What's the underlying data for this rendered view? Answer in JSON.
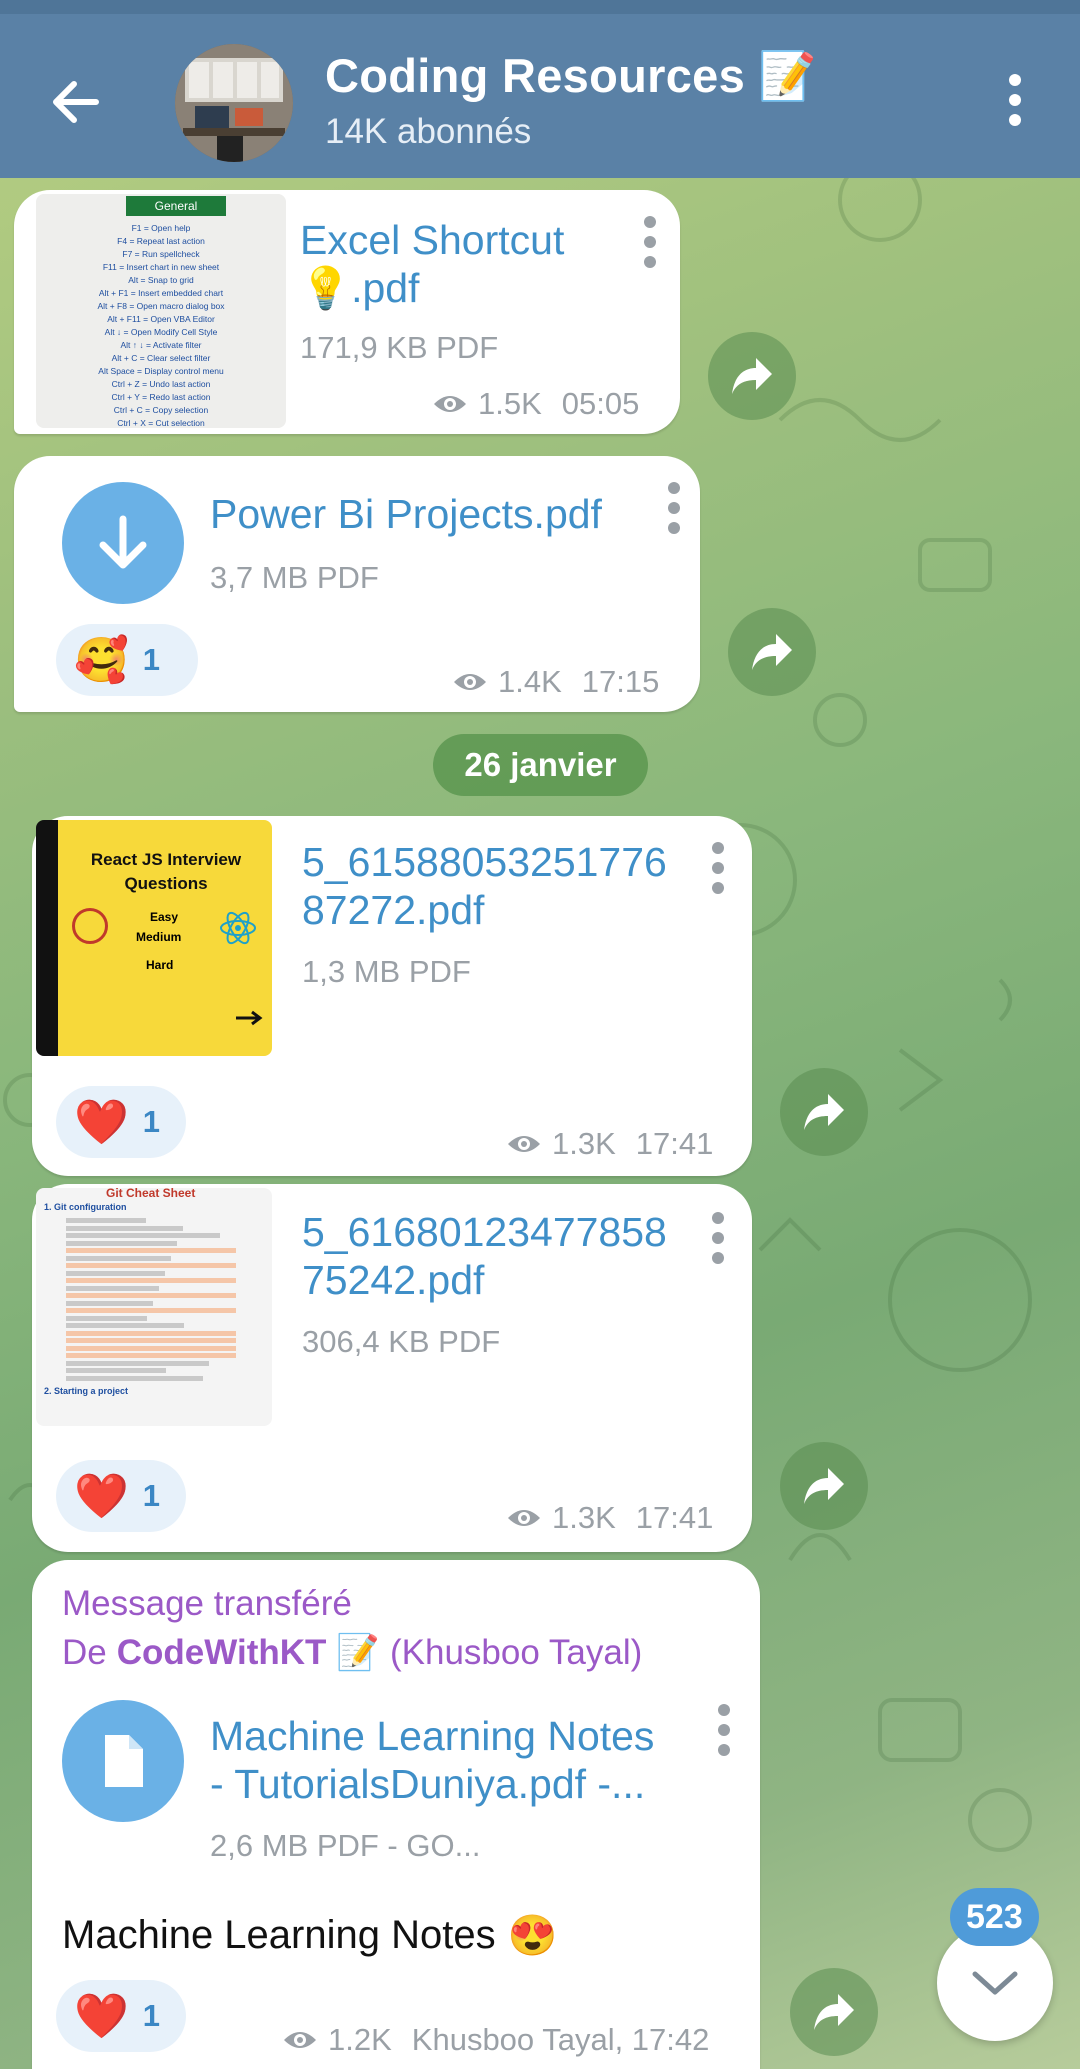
{
  "channel": {
    "title": "Coding Resources",
    "title_emoji": "📝",
    "subscribers": "14K abonnés"
  },
  "date_separator": "26 janvier",
  "messages": [
    {
      "file_name_line1": "Excel Shortcut",
      "file_name_line2": ".pdf",
      "file_emoji": "💡",
      "size": "171,9 KB PDF",
      "views": "1.5K",
      "time": "05:05",
      "thumb": {
        "header": "General",
        "lines": [
          "F1 = Open help",
          "F4 = Repeat last action",
          "F7 = Run spellcheck",
          "F11 = Insert chart in new sheet",
          "Alt = Snap to grid",
          "Alt + F1 = Insert embedded chart",
          "Alt + F8 = Open macro dialog box",
          "Alt + F11 = Open VBA Editor",
          "Alt ↓ = Open Modify Cell Style",
          "Alt ↑ ↓ = Activate filter",
          "Alt + C = Clear select filter",
          "Alt Space = Display control menu",
          "Ctrl + Z = Undo last action",
          "Ctrl + Y = Redo last action",
          "Ctrl + C = Copy selection",
          "Ctrl + X = Cut selection"
        ]
      }
    },
    {
      "file_name": "Power Bi Projects.pdf",
      "size": "3,7 MB PDF",
      "reaction_emoji": "🥰",
      "reaction_count": "1",
      "views": "1.4K",
      "time": "17:15"
    },
    {
      "file_name_line1": "5_61588053251776",
      "file_name_line2": "87272.pdf",
      "size": "1,3 MB PDF",
      "reaction_emoji": "❤️",
      "reaction_count": "1",
      "views": "1.3K",
      "time": "17:41",
      "thumb": {
        "title": "React JS Interview Questions",
        "levels": [
          "Easy",
          "Medium",
          "Hard"
        ]
      }
    },
    {
      "file_name_line1": "5_61680123477858",
      "file_name_line2": "75242.pdf",
      "size": "306,4 KB PDF",
      "reaction_emoji": "❤️",
      "reaction_count": "1",
      "views": "1.3K",
      "time": "17:41",
      "thumb": {
        "title": "Git Cheat Sheet",
        "section1": "1. Git configuration",
        "section2": "2. Starting a project"
      }
    },
    {
      "forwarded_label": "Message transféré",
      "forwarded_from_prefix": "De",
      "forwarded_from_name": "CodeWithKT",
      "forwarded_from_emoji": "📝",
      "forwarded_from_suffix": "(Khusboo Tayal)",
      "file_name_line1": "Machine Learning Notes",
      "file_name_line2": "- TutorialsDuniya.pdf -...",
      "size": "2,6 MB PDF - GO...",
      "caption": "Machine Learning Notes",
      "caption_emoji": "😍",
      "reaction_emoji": "❤️",
      "reaction_count": "1",
      "views": "1.2K",
      "signature_time": "Khusboo Tayal, 17:42"
    }
  ],
  "unread_count": "523",
  "colors": {
    "header": "#5a81a6",
    "link_blue": "#3f8fc8",
    "forward_purple": "#9b59c7",
    "date_pill_green": "#5c9650"
  },
  "icons": [
    "back-arrow-icon",
    "more-vert-icon",
    "eye-icon",
    "share-icon",
    "download-icon",
    "file-icon",
    "chevron-down-icon"
  ]
}
